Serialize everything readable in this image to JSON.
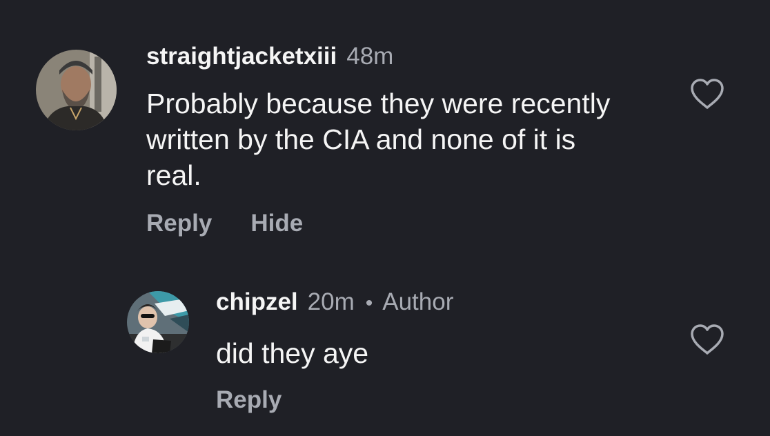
{
  "comments": [
    {
      "username": "straightjacketxiii",
      "time": "48m",
      "text": "Probably because they were recently written by the CIA and none of it is real.",
      "actions": {
        "reply": "Reply",
        "hide": "Hide"
      }
    },
    {
      "username": "chipzel",
      "time": "20m",
      "separator": "•",
      "author_label": "Author",
      "text": "did they aye",
      "actions": {
        "reply": "Reply"
      }
    }
  ],
  "icons": {
    "like": "heart-outline-icon"
  },
  "colors": {
    "background": "#1f2026",
    "primary_text": "#f5f5f5",
    "secondary_text": "#a8abb3"
  }
}
